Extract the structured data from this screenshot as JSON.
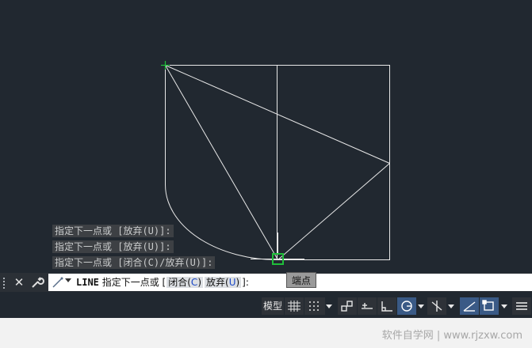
{
  "history_lines": [
    "指定下一点或 [放弃(U)]:",
    "指定下一点或 [放弃(U)]:",
    "指定下一点或 [闭合(C)/放弃(U)]:"
  ],
  "tooltip": {
    "text": "端点"
  },
  "command_line": {
    "keyword": "LINE",
    "prompt": "指定下一点或 [",
    "options": [
      {
        "label": "闭合(",
        "key": "C",
        "close": ")"
      },
      {
        "label": "放弃(",
        "key": "U",
        "close": ")"
      }
    ],
    "suffix": "]:"
  },
  "status_bar": {
    "model_label": "模型"
  },
  "footer": {
    "watermark": "软件自学网 | www.rjzxw.com"
  },
  "colors": {
    "canvas_bg": "#212830",
    "line": "#e8e8e8",
    "snap_marker": "#1fbf3a",
    "active_button": "#3a5a86"
  },
  "icons": [
    "close-icon",
    "wrench-icon",
    "line-command-icon",
    "grid-icon",
    "snap-icon",
    "infer-icon",
    "dynamic-input-icon",
    "ortho-icon",
    "polar-icon",
    "isodraft-icon",
    "object-snap-track-icon",
    "object-snap-icon",
    "customization-icon"
  ]
}
